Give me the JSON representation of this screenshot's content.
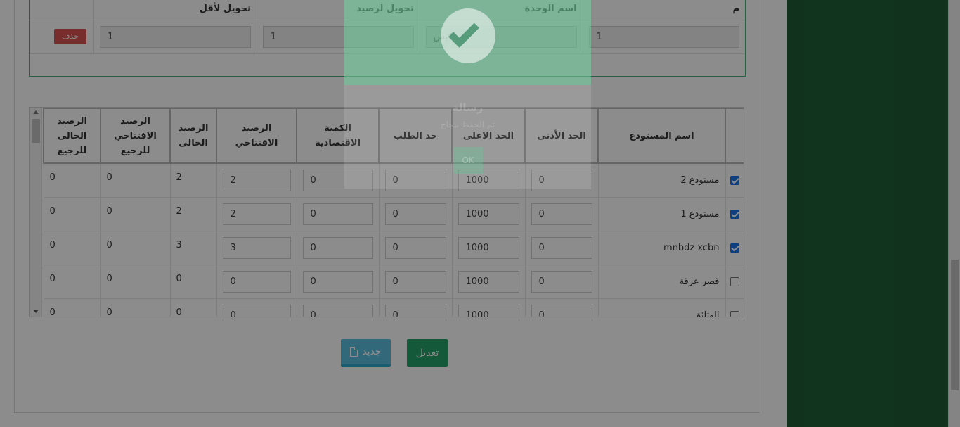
{
  "units": {
    "headers": {
      "num": "م",
      "unit_name": "اسم الوحدة",
      "balance_conv": "تحويل لرصيد",
      "min_conv": "تحويل لأقل"
    },
    "row": {
      "num": "1",
      "unit_name": "كيس",
      "balance_conv": "1",
      "min_conv": "1",
      "delete_label": "حذف"
    }
  },
  "warehouses": {
    "headers": {
      "select": "",
      "name": "اسم المستودع",
      "min": "الحد الأدنى",
      "max": "الحد الاعلى",
      "order": "حد الطلب",
      "economic_qty": "الكمية الاقتصادية",
      "opening_balance": "الرصيد الافتتاحي",
      "current_balance": "الرصيد الحالى",
      "opening_balance_ref": "الرصيد الافتتاحي للرجيع",
      "current_balance_ref": "الرصيد الحالى للرجيع"
    },
    "rows": [
      {
        "checked": true,
        "name": "مستودع 2",
        "min": "0",
        "max": "1000",
        "order": "0",
        "economic_qty": "0",
        "opening_balance": "2",
        "current_balance": "2",
        "opening_balance_ref": "0",
        "current_balance_ref": "0"
      },
      {
        "checked": true,
        "name": "مستودع 1",
        "min": "0",
        "max": "1000",
        "order": "0",
        "economic_qty": "0",
        "opening_balance": "2",
        "current_balance": "2",
        "opening_balance_ref": "0",
        "current_balance_ref": "0"
      },
      {
        "checked": true,
        "name": "mnbdz xcbn",
        "min": "0",
        "max": "1000",
        "order": "0",
        "economic_qty": "0",
        "opening_balance": "3",
        "current_balance": "3",
        "opening_balance_ref": "0",
        "current_balance_ref": "0"
      },
      {
        "checked": false,
        "name": "قصر عرقة",
        "min": "0",
        "max": "1000",
        "order": "0",
        "economic_qty": "0",
        "opening_balance": "0",
        "current_balance": "0",
        "opening_balance_ref": "0",
        "current_balance_ref": "0"
      },
      {
        "checked": false,
        "name": "الوثائق",
        "min": "0",
        "max": "1000",
        "order": "0",
        "economic_qty": "0",
        "opening_balance": "0",
        "current_balance": "0",
        "opening_balance_ref": "0",
        "current_balance_ref": "0"
      }
    ]
  },
  "buttons": {
    "new_label": "جديد",
    "edit_label": "تعديل"
  },
  "dialog": {
    "title": "رسالة",
    "message": "تم الحفظ بنجاح",
    "ok_label": "OK"
  },
  "colors": {
    "sidebar": "#1f5e37",
    "accent_green": "#26a269",
    "accent_info": "#5bc0de",
    "danger": "#d9534f"
  }
}
